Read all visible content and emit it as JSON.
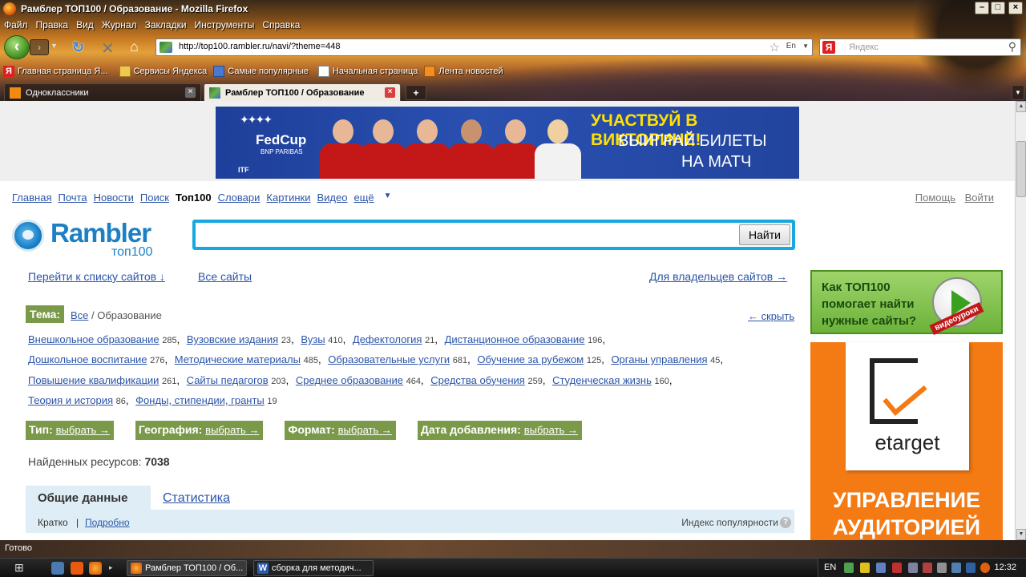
{
  "window": {
    "title": "Рамблер ТОП100 / Образование - Mozilla Firefox"
  },
  "menu": [
    "Файл",
    "Правка",
    "Вид",
    "Журнал",
    "Закладки",
    "Инструменты",
    "Справка"
  ],
  "nav": {
    "url": "http://top100.rambler.ru/navi/?theme=448",
    "lang": "En",
    "search_placeholder": "Яндекс"
  },
  "bookmarks": [
    "Главная страница Я...",
    "Сервисы Яндекса",
    "Самые популярные",
    "Начальная страница",
    "Лента новостей"
  ],
  "tabs": [
    "Одноклассники",
    "Рамблер ТОП100 / Образование"
  ],
  "banner": {
    "brand": "FedCup",
    "sponsor": "BNP PARIBAS",
    "itf": "ITF",
    "line1": "УЧАСТВУЙ В ВИКТОРИНЕ!",
    "line2": "ВЫИГРАЙ БИЛЕТЫ",
    "line3": "НА МАТЧ"
  },
  "services": {
    "items": [
      "Главная",
      "Почта",
      "Новости",
      "Поиск"
    ],
    "current": "Топ100",
    "items2": [
      "Словари",
      "Картинки",
      "Видео"
    ],
    "more": "ещё",
    "help": "Помощь",
    "login": "Войти"
  },
  "logo": {
    "word": "Rambler",
    "sub": "топ100"
  },
  "search": {
    "button": "Найти"
  },
  "links": {
    "goto_list": "Перейти к списку сайтов ↓",
    "all_sites": "Все сайты",
    "owners": "Для владельцев сайтов →"
  },
  "promo": {
    "text_line1": "Как ТОП100",
    "text_line2": "помогает найти",
    "text_line3": "нужные сайты?",
    "ribbon": "видеоуроки"
  },
  "ad": {
    "brand": "etarget",
    "slogan_line1": "УПРАВЛЕНИЕ",
    "slogan_line2": "АУДИТОРИЕЙ"
  },
  "theme": {
    "label": "Тема:",
    "all": "Все",
    "sep": " / ",
    "current": "Образование",
    "hide": "← скрыть",
    "categories": [
      {
        "name": "Внешкольное образование",
        "count": "285"
      },
      {
        "name": "Вузовские издания",
        "count": "23"
      },
      {
        "name": "Вузы",
        "count": "410"
      },
      {
        "name": "Дефектология",
        "count": "21"
      },
      {
        "name": "Дистанционное образование",
        "count": "196"
      },
      {
        "name": "Дошкольное воспитание",
        "count": "276"
      },
      {
        "name": "Методические материалы",
        "count": "485"
      },
      {
        "name": "Образовательные услуги",
        "count": "681"
      },
      {
        "name": "Обучение за рубежом",
        "count": "125"
      },
      {
        "name": "Органы управления",
        "count": "45"
      },
      {
        "name": "Повышение квалификации",
        "count": "261"
      },
      {
        "name": "Сайты педагогов",
        "count": "203"
      },
      {
        "name": "Среднее образование",
        "count": "464"
      },
      {
        "name": "Средства обучения",
        "count": "259"
      },
      {
        "name": "Студенческая жизнь",
        "count": "160"
      },
      {
        "name": "Теория и история",
        "count": "86"
      },
      {
        "name": "Фонды, стипендии, гранты",
        "count": "19"
      }
    ]
  },
  "filters": {
    "type": "Тип:",
    "geo": "География:",
    "format": "Формат:",
    "date": "Дата добавления:",
    "select": "выбрать →"
  },
  "found": {
    "label": "Найденных ресурсов:",
    "count": "7038"
  },
  "datatabs": {
    "general": "Общие данные",
    "stats": "Статистика",
    "brief": "Кратко",
    "pipe": "|",
    "detail": "Подробно",
    "popularity": "Индекс популярности",
    "help": "?"
  },
  "status": "Готово",
  "taskbar": {
    "task1": "Рамблер ТОП100 / Об...",
    "task2": "сборка для методич...",
    "lang": "EN",
    "clock": "12:32"
  }
}
